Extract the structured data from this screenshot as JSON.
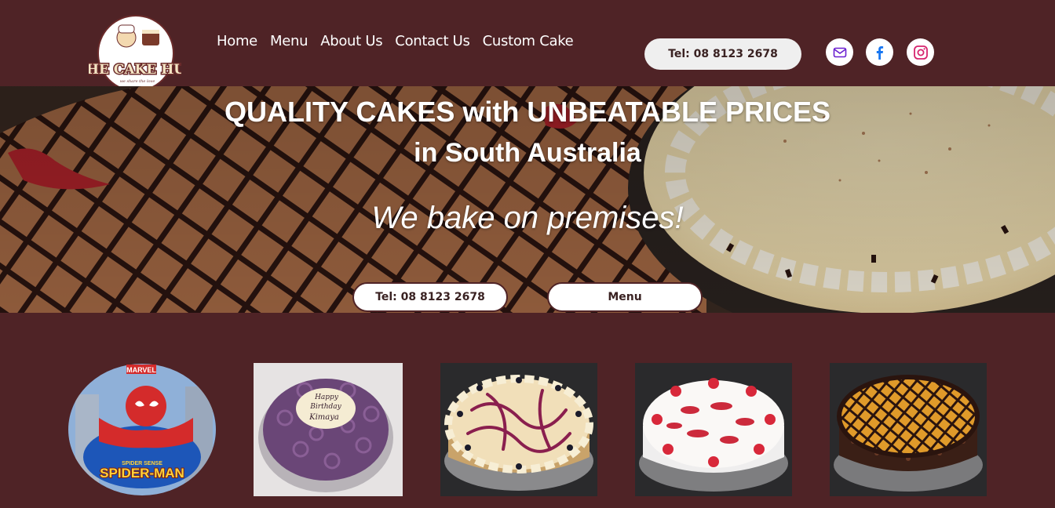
{
  "brand": {
    "logo_text": "THE CAKE HUT",
    "logo_tagline": "we share the love"
  },
  "nav": {
    "items": [
      "Home",
      "Menu",
      "About Us",
      "Contact Us",
      "Custom Cake"
    ]
  },
  "header": {
    "tel_label": "Tel: 08 8123 2678"
  },
  "social": {
    "icons": [
      "mail-icon",
      "facebook-icon",
      "instagram-icon"
    ]
  },
  "hero": {
    "title_line1": "QUALITY CAKES with UNBEATABLE PRICES",
    "title_line2": "in South Australia",
    "tagline": "We bake on premises!",
    "tel_button": "Tel: 08 8123 2678",
    "menu_button": "Menu"
  },
  "gallery": {
    "items": [
      {
        "name": "spiderman-cake",
        "label_top": "MARVEL",
        "label_bottom": "SPIDER-MAN",
        "label_small": "SPIDER SENSE"
      },
      {
        "name": "birthday-cake",
        "plaque_line1": "Happy",
        "plaque_line2": "Birthday",
        "plaque_line3": "Kimaya"
      },
      {
        "name": "berry-cheesecake"
      },
      {
        "name": "strawberry-cheesecake"
      },
      {
        "name": "chocolate-orange-cake"
      }
    ]
  },
  "colors": {
    "background": "#4f2326",
    "pill": "#efefef",
    "mail": "#6a1fd0",
    "facebook": "#1877f2",
    "instagram": "#d6246e"
  }
}
